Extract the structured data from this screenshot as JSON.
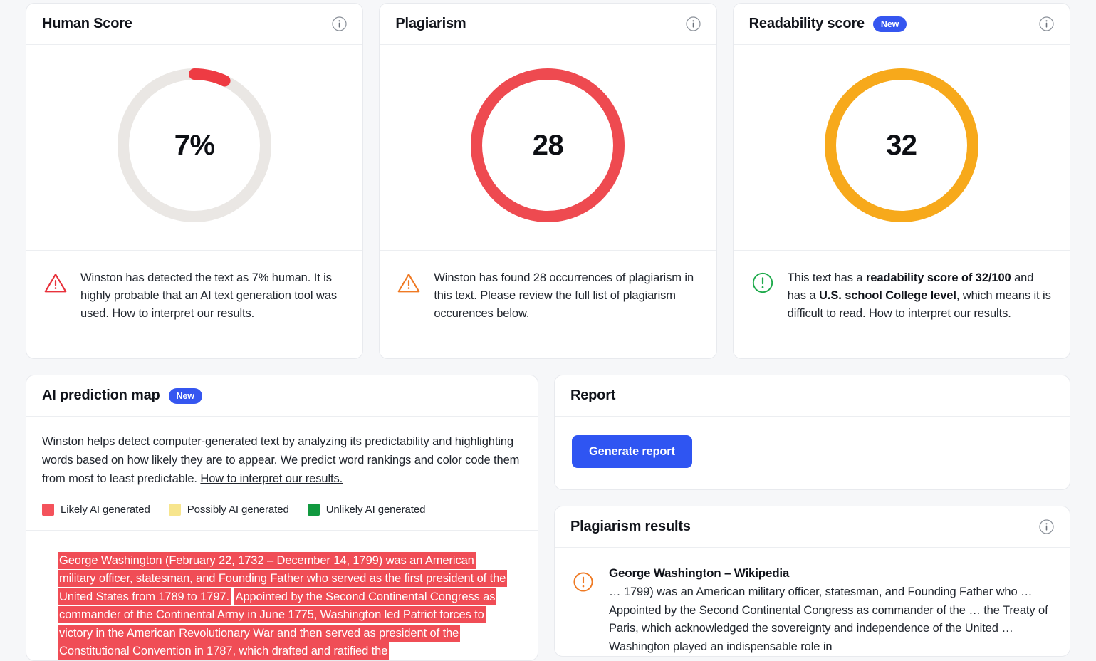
{
  "scores": [
    {
      "title": "Human Score",
      "icon": "info-icon",
      "gauge": {
        "value_label": "7%",
        "percent": 7,
        "arc_color": "#ee3b43",
        "track_color": "#eae7e4"
      },
      "footer": {
        "icon": "warning-triangle-icon",
        "icon_color": "#e8323c",
        "text_before": "Winston has detected the text as 7% human. It is highly probable that an AI text generation tool was used. ",
        "link": "How to interpret our results."
      }
    },
    {
      "title": "Plagiarism",
      "icon": "info-icon",
      "gauge": {
        "value_label": "28",
        "percent": 100,
        "arc_color": "#ee4a50",
        "track_color": "#ffffff"
      },
      "footer": {
        "icon": "warning-triangle-icon",
        "icon_color": "#ef7a24",
        "text_before": "Winston has found 28 occurrences of plagiarism in this text. Please review the full list of plagiarism occurences below.",
        "link": ""
      }
    },
    {
      "title": "Readability score",
      "badge": "New",
      "icon": "info-icon",
      "gauge": {
        "value_label": "32",
        "percent": 100,
        "arc_color": "#f7a91b",
        "track_color": "#ffffff"
      },
      "footer": {
        "icon": "exclamation-circle-icon",
        "icon_color": "#1eaa4b",
        "segments": [
          {
            "text": "This text has a ",
            "bold": false
          },
          {
            "text": "readability score of 32/100",
            "bold": true
          },
          {
            "text": " and has a ",
            "bold": false
          },
          {
            "text": "U.S. school College level",
            "bold": true
          },
          {
            "text": ", which means it is difficult to read. ",
            "bold": false
          }
        ],
        "link": "How to interpret our results."
      }
    }
  ],
  "prediction_map": {
    "title": "AI prediction map",
    "badge": "New",
    "info_icon": "info-icon",
    "description": "Winston helps detect computer-generated text by analyzing its predictability and highlighting words based on how likely they are to appear. We predict word rankings and color code them from most to least predictable. ",
    "description_link": "How to interpret our results.",
    "legend": [
      {
        "label": "Likely AI generated",
        "color": "#f4525b"
      },
      {
        "label": "Possibly AI generated",
        "color": "#f7e58d"
      },
      {
        "label": "Unlikely AI generated",
        "color": "#11993f"
      }
    ],
    "highlighted_segments": [
      {
        "level": "likely",
        "text": "George Washington (February 22, 1732 – December 14, 1799) was an American military officer, statesman, and Founding Father who served as the first president of the United States from 1789 to 1797."
      },
      {
        "level": "likely",
        "text": "Appointed by the Second Continental Congress as commander of the Continental Army in June 1775, Washington led Patriot forces to victory in the American Revolutionary War and then served as president of the Constitutional Convention in 1787, which drafted and ratified the"
      }
    ]
  },
  "report": {
    "title": "Report",
    "generate_label": "Generate report"
  },
  "plagiarism_results": {
    "title": "Plagiarism results",
    "info_icon": "info-icon",
    "items": [
      {
        "icon": "exclamation-circle-icon",
        "icon_color": "#ef7a24",
        "source_title": "George Washington – Wikipedia",
        "snippet": "… 1799) was an American military officer, statesman, and Founding Father who … Appointed by the Second Continental Congress as commander of the … the Treaty of Paris, which acknowledged the sovereignty and independence of the United … Washington played an indispensable role in"
      }
    ]
  }
}
